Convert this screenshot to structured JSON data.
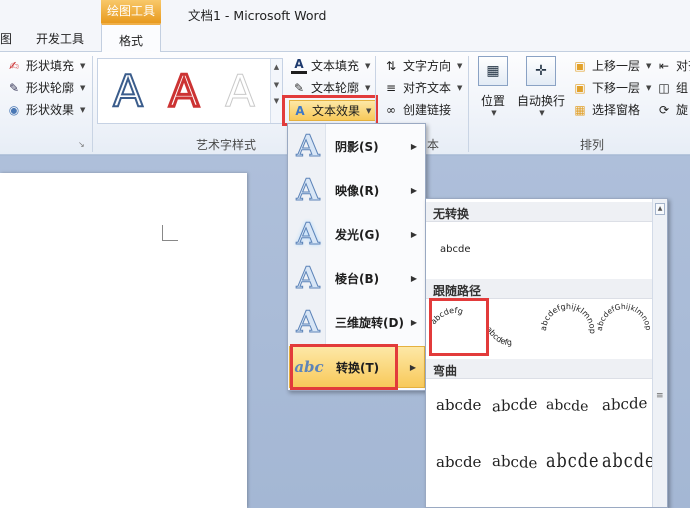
{
  "titlebar": {
    "context_tab": "绘图工具",
    "doc_title": "文档1  -  Microsoft Word"
  },
  "tabs": {
    "partial": "图",
    "developer": "开发工具",
    "format": "格式"
  },
  "ribbon": {
    "shape_styles": {
      "fill": "形状填充",
      "outline": "形状轮廓",
      "effects": "形状效果"
    },
    "wordart": {
      "glyph": "A",
      "text_fill": "文本填充",
      "text_outline": "文本轮廓",
      "text_effects": "文本效果",
      "group_label": "艺术字样式"
    },
    "text": {
      "direction": "文字方向",
      "align": "对齐文本",
      "link": "创建链接",
      "group_label_partial": "本"
    },
    "arrange": {
      "position": "位置",
      "wrap": "自动换行",
      "bring_forward": "上移一层",
      "send_backward": "下移一层",
      "selection_pane": "选择窗格",
      "align_partial": "对齐",
      "group_partial": "组",
      "rotate_partial": "旋",
      "group_label": "排列"
    }
  },
  "effects_menu": {
    "items": [
      {
        "label": "阴影(S)",
        "icon": "A"
      },
      {
        "label": "映像(R)",
        "icon": "A"
      },
      {
        "label": "发光(G)",
        "icon": "A"
      },
      {
        "label": "棱台(B)",
        "icon": "A"
      },
      {
        "label": "三维旋转(D)",
        "icon": "A"
      },
      {
        "label": "转换(T)",
        "icon": "abc"
      }
    ]
  },
  "transform_menu": {
    "no_transform": "无转换",
    "sample": "abcde",
    "follow_path": "跟随路径",
    "path_samples": [
      "abcdefg",
      "abcdefg",
      "abcdefghijklmnop",
      "abcdefGhijklmnop"
    ],
    "warp": "弯曲",
    "warp_samples": [
      "abcde",
      "abcde",
      "abcde",
      "abcde",
      "abcde",
      "abcde",
      "abcde",
      "abcde"
    ]
  },
  "colors": {
    "highlight_border": "#e23b3b",
    "menu_highlight": "#f8c95a",
    "context_tab": "#e89a1e"
  }
}
